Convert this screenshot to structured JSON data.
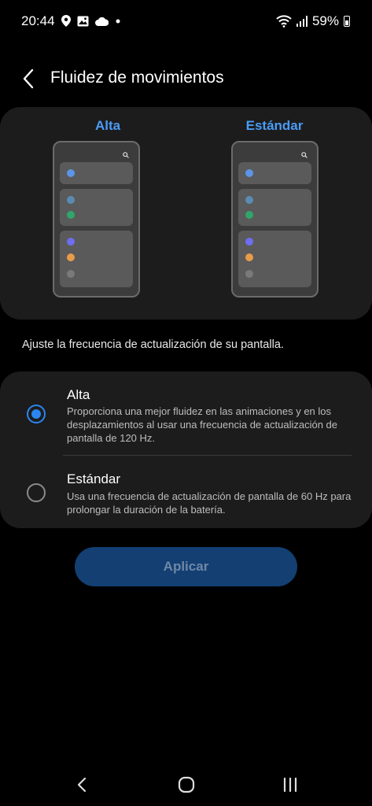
{
  "status_bar": {
    "time": "20:44",
    "battery_percent": "59%",
    "left_icons": [
      "location-pin-icon",
      "image-icon",
      "cloud-icon",
      "dot-icon"
    ],
    "right_icons": [
      "wifi-icon",
      "signal-icon",
      "battery-icon"
    ]
  },
  "header": {
    "title": "Fluidez de movimientos"
  },
  "preview": {
    "left_label": "Alta",
    "right_label": "Estándar",
    "accent_color": "#4a9bf6",
    "dot_colors": [
      "#5b95e6",
      "#5a8cb3",
      "#2fa66a",
      "#6e6ef0",
      "#e79c48",
      "#7a7a7a"
    ]
  },
  "description": "Ajuste la frecuencia de actualización de su pantalla.",
  "options": [
    {
      "title": "Alta",
      "description": "Proporciona una mejor fluidez en las animaciones y en los desplazamientos al usar una frecuencia de actualización de pantalla de 120 Hz.",
      "selected": true
    },
    {
      "title": "Estándar",
      "description": "Usa una frecuencia de actualización de pantalla de 60 Hz para prolongar la duración de la batería.",
      "selected": false
    }
  ],
  "apply_label": "Aplicar",
  "nav": [
    "back-icon",
    "home-icon",
    "recents-icon"
  ]
}
